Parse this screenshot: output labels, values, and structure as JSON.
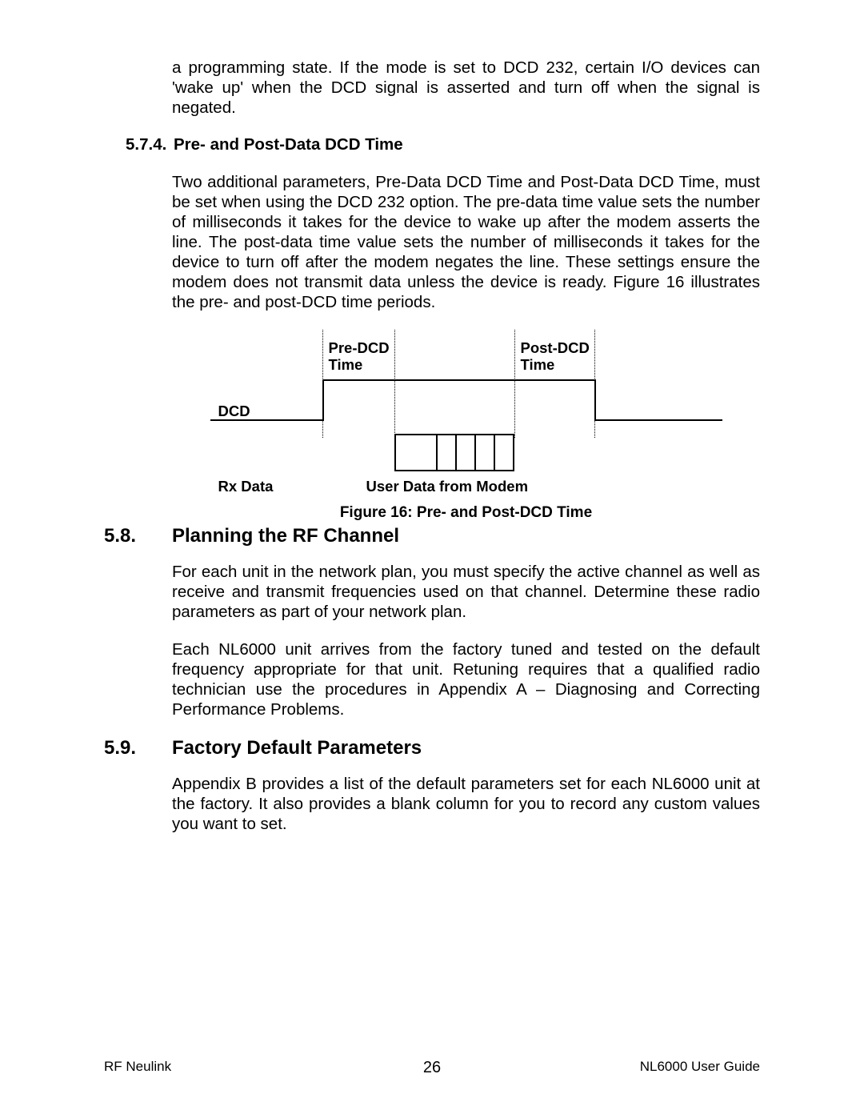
{
  "intro_para": "a programming state. If the mode is set to DCD 232, certain I/O devices can 'wake up' when the DCD signal is asserted and turn off when the signal is negated.",
  "s574": {
    "num": "5.7.4.",
    "title": "Pre- and Post-Data DCD Time",
    "para": "Two additional parameters, Pre-Data DCD Time and Post-Data DCD Time, must be set when using the DCD 232 option. The pre-data time value sets the number of milliseconds it takes for the device to wake up after the modem asserts the line. The post-data time value sets the number of milliseconds it takes for the device to turn off after the modem negates the line. These settings ensure the modem does not transmit data unless the device is ready. Figure 16 illustrates the pre- and post-DCD time periods."
  },
  "fig16": {
    "pre_label": "Pre-DCD\nTime",
    "post_label": "Post-DCD\nTime",
    "dcd_label": "DCD",
    "rx_label": "Rx Data",
    "user_label": "User Data from Modem",
    "caption": "Figure 16: Pre- and Post-DCD Time"
  },
  "s58": {
    "num": "5.8.",
    "title": "Planning the RF Channel",
    "p1": "For each unit in the network plan, you must specify the active channel as well as receive and transmit frequencies used on that channel. Determine these radio parameters as part of your network plan.",
    "p2": "Each NL6000 unit arrives from the factory tuned and tested on the default frequency appropriate for that unit. Retuning requires that a qualified radio technician use the procedures in Appendix A – Diagnosing and Correcting Performance Problems."
  },
  "s59": {
    "num": "5.9.",
    "title": "Factory Default Parameters",
    "p1": "Appendix B provides a list of the default parameters set for each NL6000 unit at the factory. It also provides a blank column for you to record any custom values you want to set."
  },
  "footer": {
    "left": "RF Neulink",
    "center": "26",
    "right": "NL6000 User Guide"
  }
}
